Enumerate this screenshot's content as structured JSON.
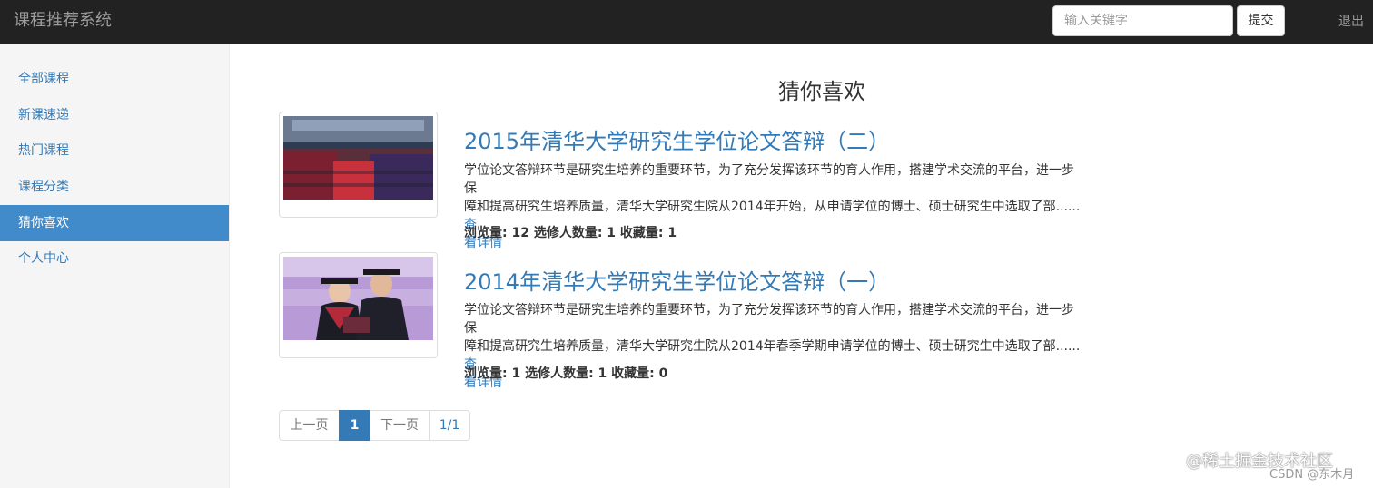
{
  "navbar": {
    "brand": "课程推荐系统",
    "search_placeholder": "输入关键字",
    "submit_label": "提交",
    "logout_label": "退出"
  },
  "sidebar": {
    "items": [
      {
        "label": "全部课程",
        "active": false
      },
      {
        "label": "新课速递",
        "active": false
      },
      {
        "label": "热门课程",
        "active": false
      },
      {
        "label": "课程分类",
        "active": false
      },
      {
        "label": "猜你喜欢",
        "active": true
      },
      {
        "label": "个人中心",
        "active": false
      }
    ]
  },
  "main": {
    "title": "猜你喜欢",
    "courses": [
      {
        "title": "2015年清华大学研究生学位论文答辩（二）",
        "desc_line1": "学位论文答辩环节是研究生培养的重要环节，为了充分发挥该环节的育人作用，搭建学术交流的平台，进一步保",
        "desc_line2": "障和提高研究生培养质量，清华大学研究生院从2014年开始，从申请学位的博士、硕士研究生中选取了部......",
        "more_a": "查",
        "more_b": "看详情",
        "stats": "浏览量: 12 选修人数量: 1 收藏量: 1"
      },
      {
        "title": "2014年清华大学研究生学位论文答辩（一）",
        "desc_line1": "学位论文答辩环节是研究生培养的重要环节，为了充分发挥该环节的育人作用，搭建学术交流的平台，进一步保",
        "desc_line2": "障和提高研究生培养质量，清华大学研究生院从2014年春季学期申请学位的博士、硕士研究生中选取了部......",
        "more_a": "查",
        "more_b": "看详情",
        "stats": "浏览量: 1 选修人数量: 1 收藏量: 0"
      }
    ]
  },
  "pagination": {
    "prev": "上一页",
    "current": "1",
    "next": "下一页",
    "info": "1/1"
  },
  "watermark": {
    "line1": "@稀土掘金技术社区",
    "line2": "CSDN @东木月"
  },
  "colors": {
    "navbar_bg": "#222222",
    "link": "#337ab7",
    "active_bg": "#428bca"
  }
}
